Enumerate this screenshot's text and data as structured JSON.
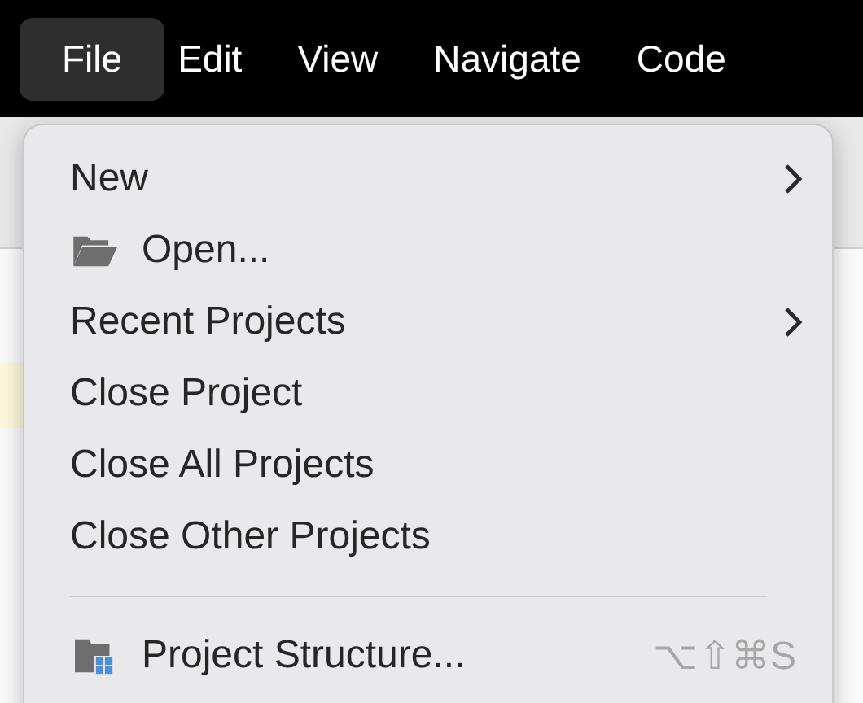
{
  "menu_bar": [
    {
      "label": "File",
      "selected": true
    },
    {
      "label": "Edit",
      "selected": false
    },
    {
      "label": "View",
      "selected": false
    },
    {
      "label": "Navigate",
      "selected": false
    },
    {
      "label": "Code",
      "selected": false
    }
  ],
  "file_menu": [
    {
      "kind": "item",
      "label": "New",
      "submenu": true
    },
    {
      "kind": "folder",
      "label": "Open..."
    },
    {
      "kind": "item",
      "label": "Recent Projects",
      "submenu": true
    },
    {
      "kind": "item",
      "label": "Close Project"
    },
    {
      "kind": "item",
      "label": "Close All Projects"
    },
    {
      "kind": "item",
      "label": "Close Other Projects"
    },
    {
      "kind": "separator"
    },
    {
      "kind": "structure",
      "label": "Project Structure...",
      "shortcut": "⌥⇧⌘S"
    }
  ]
}
